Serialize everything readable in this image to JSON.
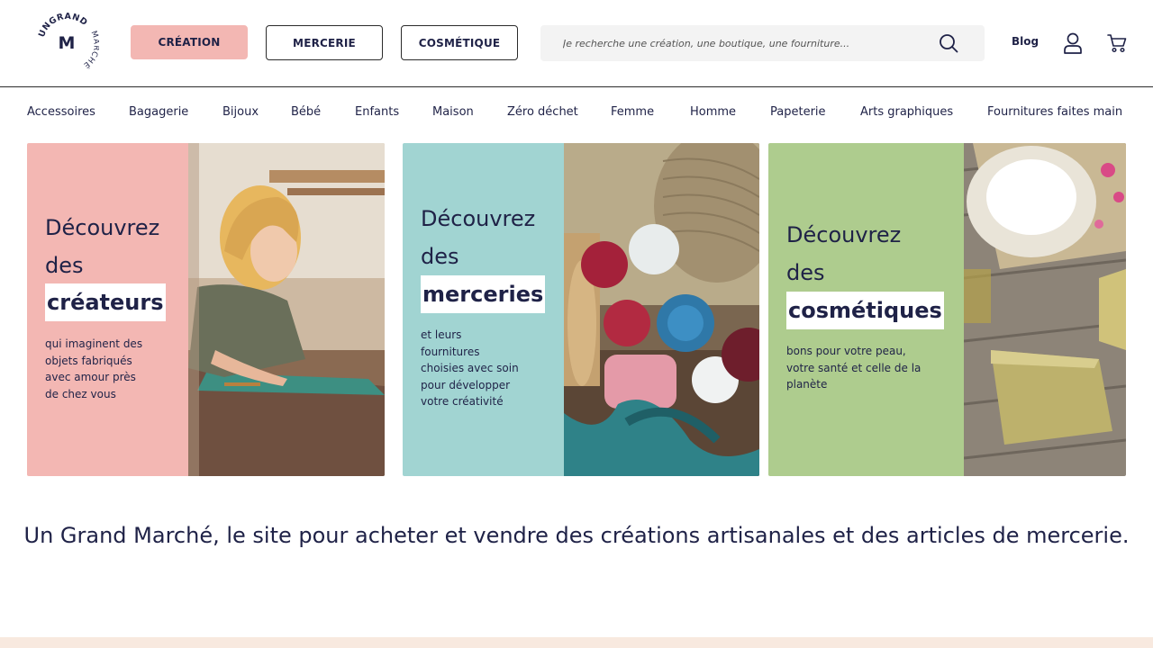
{
  "header": {
    "logo_text": {
      "top": "UNGRAND",
      "center": "M",
      "bottom": "MARCHÉ"
    },
    "categories": [
      "CRÉATION",
      "MERCERIE",
      "COSMÉTIQUE"
    ],
    "search_placeholder": "Je recherche une création, une boutique, une fourniture...",
    "blog_label": "Blog",
    "icons": [
      "search-icon",
      "user-icon",
      "cart-icon"
    ]
  },
  "nav": {
    "items": [
      "Accessoires",
      "Bagagerie",
      "Bijoux",
      "Bébé",
      "Enfants",
      "Maison",
      "Zéro déchet",
      "Femme",
      "Homme",
      "Papeterie",
      "Arts graphiques",
      "Fournitures faites main"
    ]
  },
  "cards": [
    {
      "line1": "Découvrez",
      "line2": "des",
      "highlight": "créateurs",
      "desc": [
        "qui imaginent des",
        "objets fabriqués",
        "avec amour près",
        "de chez vous"
      ],
      "color": "#f3b7b3"
    },
    {
      "line1": "Découvrez",
      "line2": "des",
      "highlight": "merceries",
      "desc": [
        "et leurs",
        "fournitures",
        "choisies avec soin",
        "pour développer",
        "votre créativité"
      ],
      "color": "#a1d4d2"
    },
    {
      "line1": "Découvrez",
      "line2": "des",
      "highlight": "cosmétiques",
      "desc": [
        "bons pour votre peau,",
        "votre santé et celle de la",
        "planète"
      ],
      "color": "#aecc8e"
    }
  ],
  "tagline": "Un Grand Marché, le site pour acheter et vendre des créations artisanales et des articles de mercerie.",
  "colors": {
    "text": "#1f2247",
    "creation": "#f3b7b3",
    "footer": "#f8e9df"
  }
}
